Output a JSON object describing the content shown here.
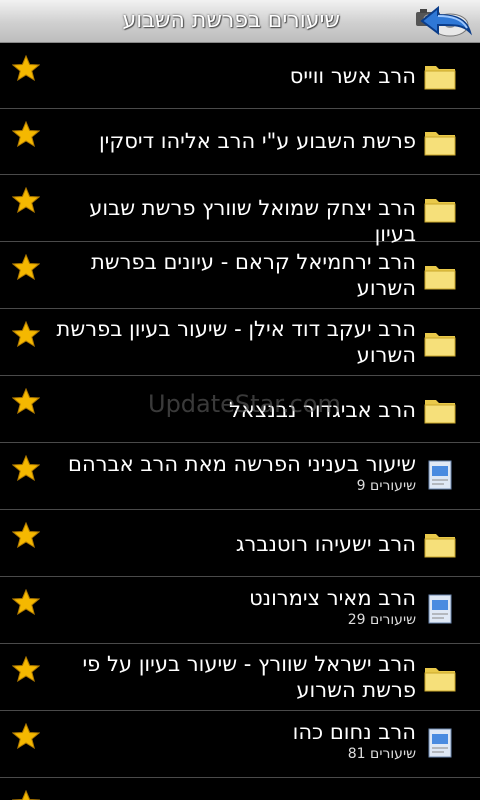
{
  "header": {
    "title": "שיעורים בפרשת השבוע",
    "back_icon": "back-arrow-icon",
    "tools_icon": "camera-disc-icon"
  },
  "items": [
    {
      "title": "הרב אשר ווייס",
      "subtitle": "",
      "icon": "folder-icon",
      "star": true
    },
    {
      "title": "פרשת השבוע ע\"י הרב אליהו דיסקין",
      "subtitle": "",
      "icon": "folder-icon",
      "star": true
    },
    {
      "title": "הרב יצחק שמואל שוורץ פרשת שבוע בעיון",
      "subtitle": "",
      "icon": "folder-icon",
      "star": true
    },
    {
      "title": "הרב ירחמיאל קראם - עיונים בפרשת השרוע",
      "subtitle": "",
      "icon": "folder-icon",
      "star": true
    },
    {
      "title": "הרב יעקב דוד אילן - שיעור בעיון בפרשת השרוע",
      "subtitle": "",
      "icon": "folder-icon",
      "star": true
    },
    {
      "title": "הרב אביגדור נבנצאל",
      "subtitle": "",
      "icon": "folder-icon",
      "star": true
    },
    {
      "title": "שיעור בעניני הפרשה מאת  הרב אברהם",
      "subtitle": "שיעורים 9",
      "icon": "document-icon",
      "star": true
    },
    {
      "title": "הרב ישעיהו רוטנברג",
      "subtitle": "",
      "icon": "folder-icon",
      "star": true
    },
    {
      "title": "הרב מאיר צימרונט",
      "subtitle": "שיעורים 29",
      "icon": "document-icon",
      "star": true
    },
    {
      "title": "הרב ישראל שוורץ - שיעור בעיון על פי פרשת השרוע",
      "subtitle": "",
      "icon": "folder-icon",
      "star": true
    },
    {
      "title": "הרב נחום כהו",
      "subtitle": "שיעורים 81",
      "icon": "document-icon",
      "star": true
    },
    {
      "title": "",
      "subtitle": "",
      "icon": "folder-icon",
      "star": true
    }
  ],
  "watermark": "UpdateStar.com",
  "colors": {
    "star": "#f5b800",
    "folder": "#f3dc63",
    "separator": "#4a4a4a"
  }
}
